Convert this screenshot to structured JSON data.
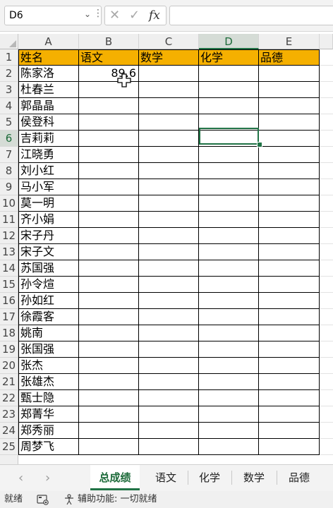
{
  "formula_bar": {
    "name_box": "D6",
    "name_box_caret": "⌄",
    "more_dots": "⋮",
    "cancel_glyph": "✕",
    "enter_glyph": "✓",
    "fx_glyph": "fx",
    "formula_value": ""
  },
  "columns": [
    "A",
    "B",
    "C",
    "D",
    "E"
  ],
  "rows": [
    "1",
    "2",
    "3",
    "4",
    "5",
    "6",
    "7",
    "8",
    "9",
    "10",
    "11",
    "12",
    "13",
    "14",
    "15",
    "16",
    "17",
    "18",
    "19",
    "20",
    "21",
    "22",
    "23",
    "24",
    "25"
  ],
  "header_row": [
    "姓名",
    "语文",
    "数学",
    "化学",
    "品德"
  ],
  "header_fill": "#f5b000",
  "names": [
    "陈家洛",
    "杜春兰",
    "郭晶晶",
    "侯登科",
    "吉莉莉",
    "江晓勇",
    "刘小红",
    "马小军",
    "莫一明",
    "齐小娟",
    "宋子丹",
    "宋子文",
    "苏国强",
    "孙令煊",
    "孙如红",
    "徐霞客",
    "姚南",
    "张国强",
    "张杰",
    "张雄杰",
    "甄士隐",
    "郑菁华",
    "郑秀丽",
    "周梦飞"
  ],
  "b2_value": "89.6",
  "selected_cell": "D6",
  "accent": "#217346",
  "sheet_tabs": [
    "总成绩",
    "语文",
    "化学",
    "数学",
    "品德"
  ],
  "active_sheet": "总成绩",
  "nav": {
    "prev": "‹",
    "next": "›"
  },
  "status": {
    "ready": "就绪",
    "accessibility": "辅助功能: 一切就绪"
  }
}
